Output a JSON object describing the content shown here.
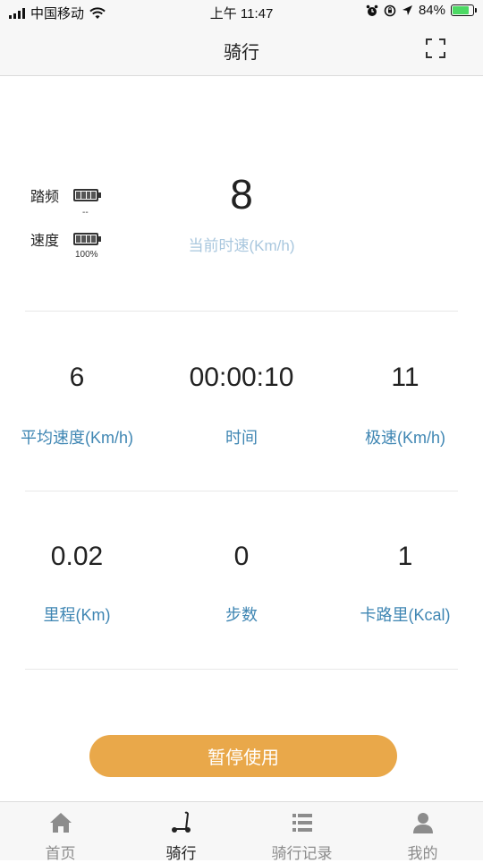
{
  "status_bar": {
    "carrier": "中国移动",
    "time": "上午 11:47",
    "battery_percent": "84%",
    "battery_level": 0.84,
    "battery_color": "#4cd964"
  },
  "nav": {
    "title": "骑行",
    "fullscreen_icon": "fullscreen-icon"
  },
  "sensors": [
    {
      "label": "踏频",
      "value": "--",
      "icon": "battery-icon"
    },
    {
      "label": "速度",
      "value": "100%",
      "icon": "battery-icon"
    }
  ],
  "current_speed": {
    "value": "8",
    "label": "当前时速(Km/h)"
  },
  "stats_row1": [
    {
      "value": "6",
      "label": "平均速度(Km/h)"
    },
    {
      "value": "00:00:10",
      "label": "时间"
    },
    {
      "value": "11",
      "label": "极速(Km/h)"
    }
  ],
  "stats_row2": [
    {
      "value": "0.02",
      "label": "里程(Km)"
    },
    {
      "value": "0",
      "label": "步数"
    },
    {
      "value": "1",
      "label": "卡路里(Kcal)"
    }
  ],
  "pause_button": {
    "label": "暂停使用",
    "color": "#e9a84a"
  },
  "tabbar": {
    "tabs": [
      {
        "label": "首页",
        "icon": "home-icon",
        "active": false
      },
      {
        "label": "骑行",
        "icon": "scooter-icon",
        "active": true
      },
      {
        "label": "骑行记录",
        "icon": "list-icon",
        "active": false
      },
      {
        "label": "我的",
        "icon": "user-icon",
        "active": false
      }
    ]
  },
  "colors": {
    "accent_blue": "#3f86b3",
    "light_blue": "#a9c7de"
  }
}
